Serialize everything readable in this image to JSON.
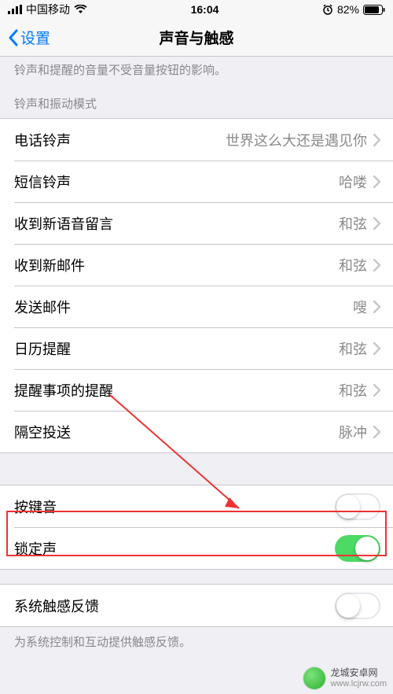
{
  "statusbar": {
    "carrier": "中国移动",
    "time": "16:04",
    "battery": "82%"
  },
  "nav": {
    "back": "设置",
    "title": "声音与触感"
  },
  "notes": {
    "volume": "铃声和提醒的音量不受音量按钮的影响。"
  },
  "section": {
    "ringer_header": "铃声和振动模式"
  },
  "rows": {
    "ringtone": {
      "label": "电话铃声",
      "value": "世界这么大还是遇见你"
    },
    "text": {
      "label": "短信铃声",
      "value": "哈喽"
    },
    "voicemail": {
      "label": "收到新语音留言",
      "value": "和弦"
    },
    "mail": {
      "label": "收到新邮件",
      "value": "和弦"
    },
    "sent": {
      "label": "发送邮件",
      "value": "嗖"
    },
    "calendar": {
      "label": "日历提醒",
      "value": "和弦"
    },
    "reminder": {
      "label": "提醒事项的提醒",
      "value": "和弦"
    },
    "airdrop": {
      "label": "隔空投送",
      "value": "脉冲"
    },
    "keyclick": {
      "label": "按键音"
    },
    "lock": {
      "label": "锁定声"
    },
    "haptics": {
      "label": "系统触感反馈"
    }
  },
  "footer": {
    "haptics_note": "为系统控制和互动提供触感反馈。"
  },
  "watermark": {
    "name": "龙城安卓网",
    "url": "www.lcjrw.com"
  }
}
